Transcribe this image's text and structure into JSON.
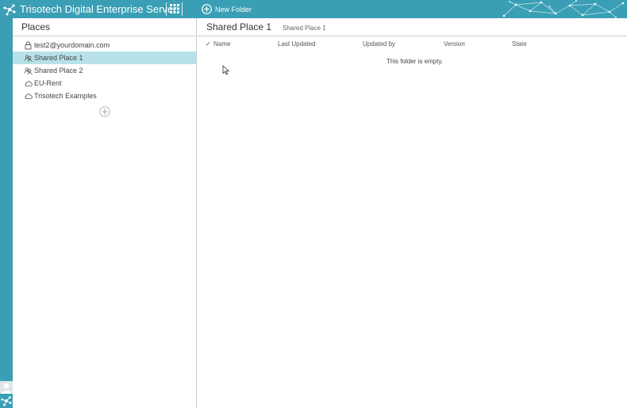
{
  "topbar": {
    "app_title": "Trisotech Digital Enterprise Server",
    "new_folder_label": "New Folder",
    "icons": [
      "trisotech-logo-icon",
      "apps-grid-icon",
      "plus-circle-icon"
    ],
    "accent_color": "#3a9fb5"
  },
  "places": {
    "heading": "Places",
    "items": [
      {
        "label": "test2@yourdomain.com",
        "icon": "lock-icon",
        "selected": false
      },
      {
        "label": "Shared Place 1",
        "icon": "shared-users-icon",
        "selected": true
      },
      {
        "label": "Shared Place 2",
        "icon": "shared-users-icon",
        "selected": false
      },
      {
        "label": "EU-Rent",
        "icon": "cloud-icon",
        "selected": false
      },
      {
        "label": "Trisotech Examples",
        "icon": "cloud-icon",
        "selected": false
      }
    ],
    "selected_color": "#b7e1e8"
  },
  "main": {
    "title": "Shared Place 1",
    "breadcrumb": "Shared Place 1",
    "columns": {
      "sort_mark": "✓",
      "name": "Name",
      "last_updated": "Last Updated",
      "updated_by": "Updated by",
      "version": "Version",
      "state": "State"
    },
    "empty_message": "This folder is empty."
  }
}
